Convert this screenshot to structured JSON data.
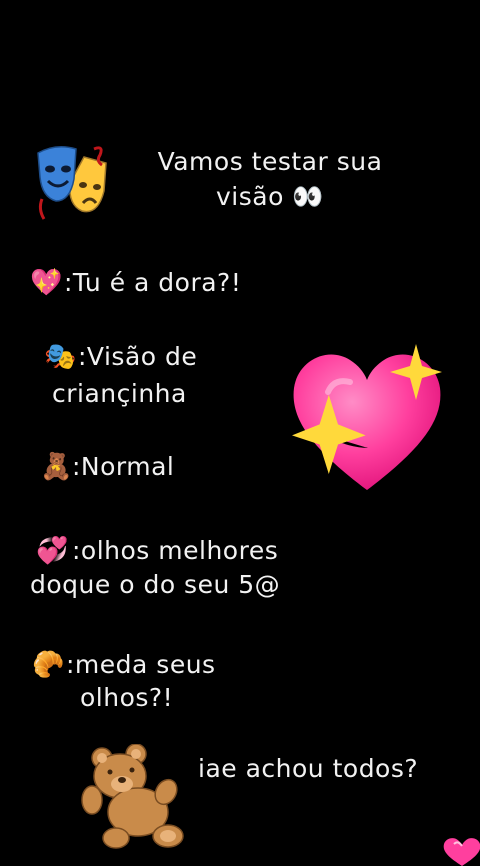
{
  "title": {
    "line1": "Vamos testar sua",
    "line2": "visão 👀"
  },
  "items": [
    {
      "icon": "💖",
      "icon_name": "sparkling-heart-icon",
      "line1": ":Tu é a dora?!",
      "line2": ""
    },
    {
      "icon": "🎭",
      "icon_name": "performing-arts-icon",
      "line1": ":Visão de",
      "line2": "crianҫinha"
    },
    {
      "icon": "🧸",
      "icon_name": "teddy-bear-icon",
      "line1": ":Normal",
      "line2": ""
    },
    {
      "icon": "💞",
      "icon_name": "revolving-hearts-icon",
      "line1": ":olhos melhores",
      "line2": "doque o do seu 5@"
    },
    {
      "icon": "🥐",
      "icon_name": "croissant-icon",
      "line1": ":meda seus",
      "line2": "olhos?!"
    }
  ],
  "footer": {
    "question": "iae achou todos?"
  },
  "colors": {
    "background": "#000000",
    "text": "#f2f2f2",
    "heart_pink": "#ff3f9e",
    "sparkle_yellow": "#ffd93b"
  }
}
